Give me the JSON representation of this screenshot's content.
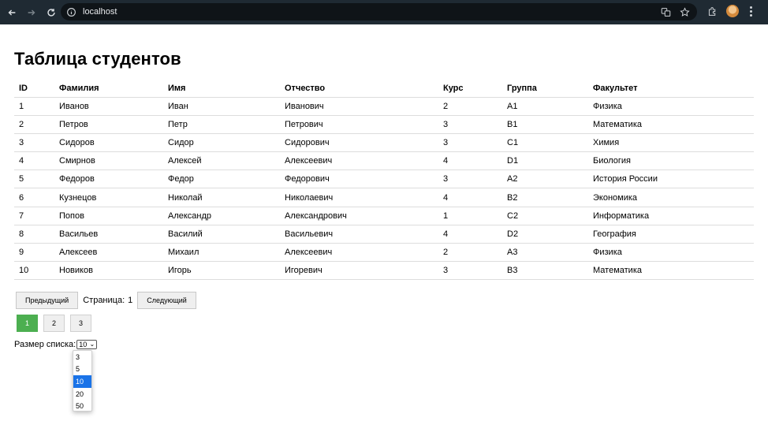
{
  "browser": {
    "url": "localhost",
    "icons": [
      "back-icon",
      "forward-icon",
      "reload-icon",
      "info-icon",
      "translate-icon",
      "star-icon",
      "extensions-icon",
      "profile-avatar",
      "menu-icon"
    ]
  },
  "page": {
    "title": "Таблица студентов"
  },
  "table": {
    "headers": [
      "ID",
      "Фамилия",
      "Имя",
      "Отчество",
      "Курс",
      "Группа",
      "Факультет"
    ],
    "rows": [
      [
        "1",
        "Иванов",
        "Иван",
        "Иванович",
        "2",
        "A1",
        "Физика"
      ],
      [
        "2",
        "Петров",
        "Петр",
        "Петрович",
        "3",
        "B1",
        "Математика"
      ],
      [
        "3",
        "Сидоров",
        "Сидор",
        "Сидорович",
        "3",
        "C1",
        "Химия"
      ],
      [
        "4",
        "Смирнов",
        "Алексей",
        "Алексеевич",
        "4",
        "D1",
        "Биология"
      ],
      [
        "5",
        "Федоров",
        "Федор",
        "Федорович",
        "3",
        "A2",
        "История России"
      ],
      [
        "6",
        "Кузнецов",
        "Николай",
        "Николаевич",
        "4",
        "B2",
        "Экономика"
      ],
      [
        "7",
        "Попов",
        "Александр",
        "Александрович",
        "1",
        "C2",
        "Информатика"
      ],
      [
        "8",
        "Васильев",
        "Василий",
        "Васильевич",
        "4",
        "D2",
        "География"
      ],
      [
        "9",
        "Алексеев",
        "Михаил",
        "Алексеевич",
        "2",
        "A3",
        "Физика"
      ],
      [
        "10",
        "Новиков",
        "Игорь",
        "Игоревич",
        "3",
        "B3",
        "Математика"
      ]
    ]
  },
  "pagination": {
    "prev_label": "Предыдущий",
    "page_label": "Страница:",
    "current_page": "1",
    "next_label": "Следующий",
    "pages": [
      "1",
      "2",
      "3"
    ],
    "active_page": "1",
    "active_color": "#4caf50"
  },
  "page_size": {
    "label": "Размер списка:",
    "selected": "10",
    "options": [
      "3",
      "5",
      "10",
      "20",
      "50"
    ]
  }
}
